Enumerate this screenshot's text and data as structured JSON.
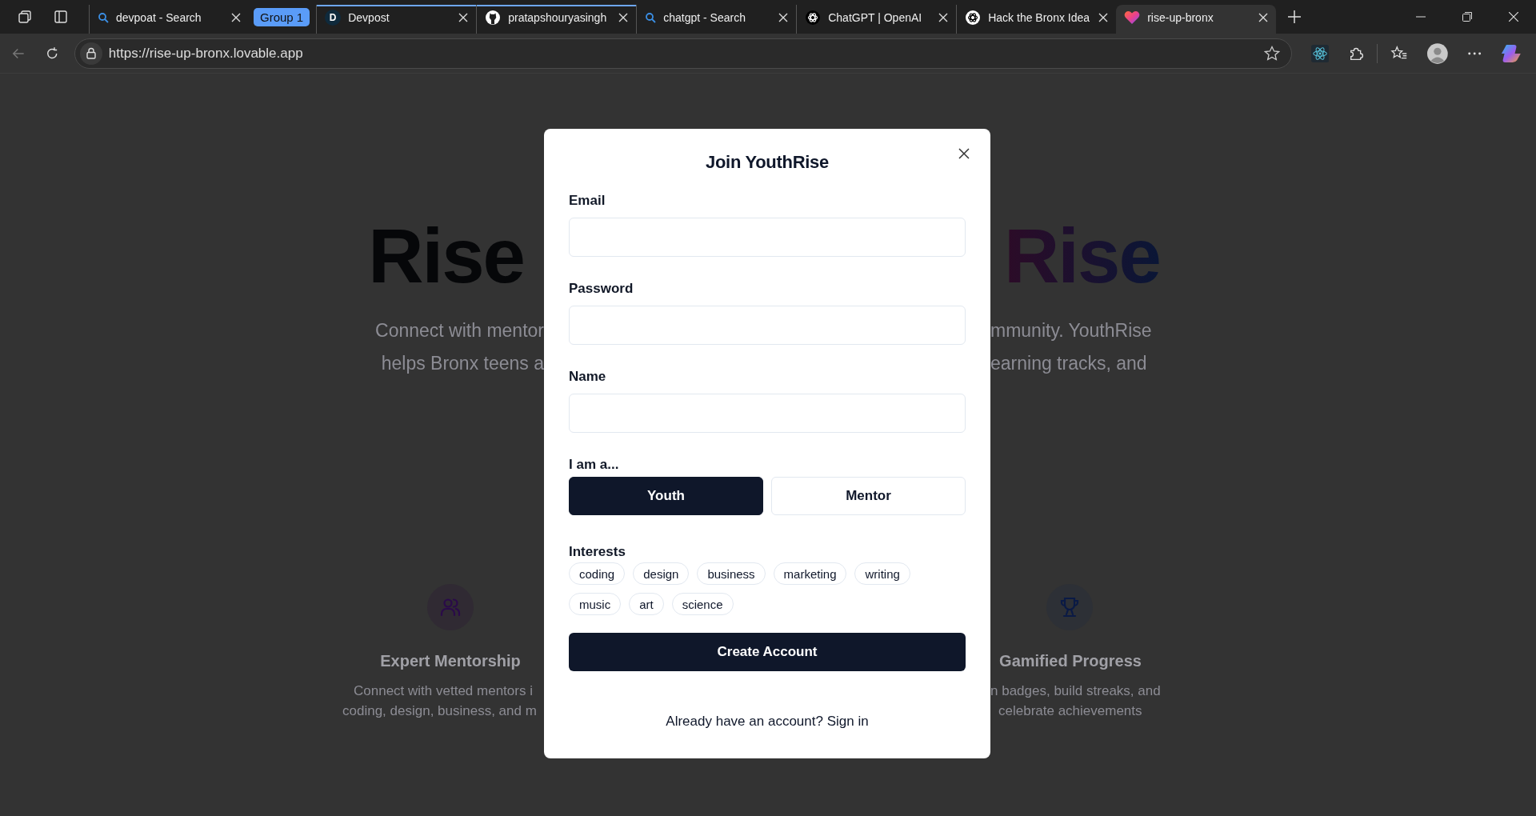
{
  "browser": {
    "tabs": [
      {
        "title": "devpoat - Search",
        "kind": "search",
        "selected": false,
        "group": false
      },
      {
        "title": "Devpost",
        "kind": "letter",
        "letter": "D",
        "selected": false,
        "group": true
      },
      {
        "title": "pratapshouryasingh",
        "kind": "github",
        "selected": false,
        "group": true
      },
      {
        "title": "chatgpt - Search",
        "kind": "search",
        "selected": false,
        "group": false
      },
      {
        "title": "ChatGPT | OpenAI",
        "kind": "openai",
        "selected": false,
        "group": false
      },
      {
        "title": "Hack the Bronx Idea",
        "kind": "openai",
        "selected": false,
        "group": false
      },
      {
        "title": "rise-up-bronx",
        "kind": "heart",
        "selected": true,
        "group": false
      }
    ],
    "tab_group": {
      "label": "Group 1"
    },
    "back": {
      "disabled": true
    },
    "url": "https://rise-up-bronx.lovable.app"
  },
  "page": {
    "hero": {
      "left_title": "Rise",
      "right_title": "Rise",
      "left_lines": [
        "Connect with mentor",
        "helps Bronx teens a"
      ],
      "right_lines": [
        "mmunity. YouthRise",
        "earning tracks, and"
      ]
    },
    "features": [
      {
        "kind": "people",
        "title": "Expert Mentorship",
        "lines": [
          "Connect with vetted mentors i",
          "coding, design, business, and m"
        ]
      },
      {
        "kind": "trophy",
        "title": "Gamified Progress",
        "lines": [
          "n badges, build streaks, and",
          "celebrate achievements"
        ]
      }
    ]
  },
  "modal": {
    "title": "Join YouthRise",
    "fields": [
      {
        "label": "Email"
      },
      {
        "label": "Password"
      },
      {
        "label": "Name"
      }
    ],
    "role": {
      "label": "I am a...",
      "options": [
        {
          "label": "Youth",
          "selected": true
        },
        {
          "label": "Mentor",
          "selected": false
        }
      ]
    },
    "interests": {
      "label": "Interests",
      "chips": [
        {
          "label": "coding",
          "selected": false
        },
        {
          "label": "design",
          "selected": false
        },
        {
          "label": "business",
          "selected": false
        },
        {
          "label": "marketing",
          "selected": false
        },
        {
          "label": "writing",
          "selected": false
        },
        {
          "label": "music",
          "selected": false
        },
        {
          "label": "art",
          "selected": false
        },
        {
          "label": "science",
          "selected": false
        }
      ]
    },
    "submit": "Create Account",
    "footer": "Already have an account? Sign in"
  }
}
